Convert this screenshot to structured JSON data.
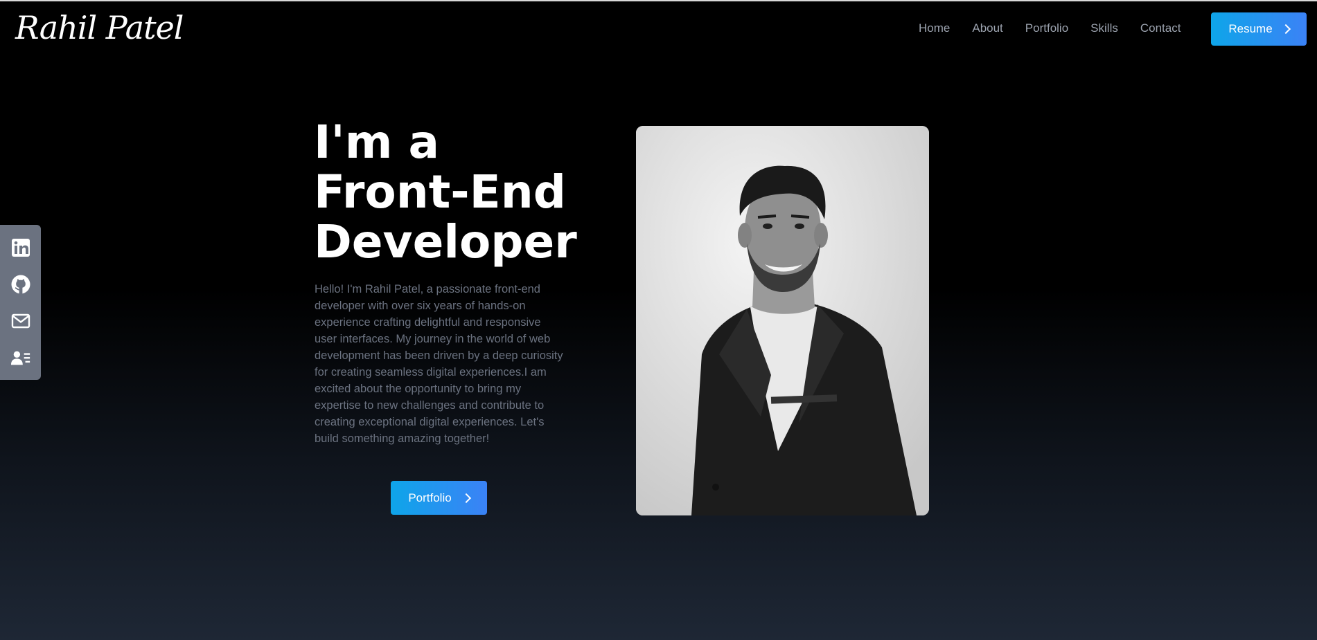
{
  "header": {
    "logo": "Rahil Patel",
    "nav": [
      "Home",
      "About",
      "Portfolio",
      "Skills",
      "Contact"
    ],
    "resume_label": "Resume"
  },
  "social": [
    "linkedin-icon",
    "github-icon",
    "mail-icon",
    "contact-card-icon"
  ],
  "hero": {
    "heading_lines": [
      "I'm a",
      "Front-End",
      "Developer"
    ],
    "bio": "Hello! I'm Rahil Patel, a passionate front-end developer with over six years of hands-on experience crafting delightful and responsive user interfaces. My journey in the world of web development has been driven by a deep curiosity for creating seamless digital experiences.I am excited about the opportunity to bring my expertise to new challenges and contribute to creating exceptional digital experiences. Let's build something amazing together!",
    "cta_label": "Portfolio"
  },
  "colors": {
    "accent_start": "#0ea5e9",
    "accent_end": "#3b82f6",
    "nav_text": "#9ca3af",
    "bio_text": "#6b7280"
  }
}
